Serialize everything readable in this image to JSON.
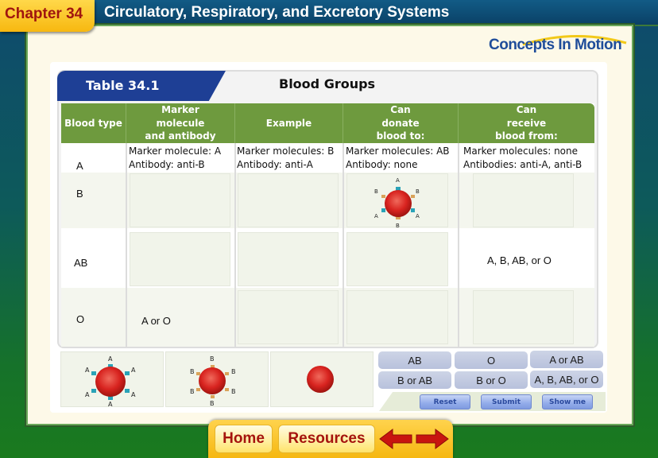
{
  "header": {
    "chapter": "Chapter 34",
    "title": "Circulatory, Respiratory, and Excretory Systems"
  },
  "logo": {
    "text": "Concepts In Motion"
  },
  "table": {
    "tab_label": "Table 34.1",
    "heading": "Blood Groups",
    "columns": [
      "Blood type",
      "Marker\nmolecule\nand antibody",
      "Example",
      "Can\ndonate\nblood to:",
      "Can\nreceive\nblood from:"
    ],
    "rows": [
      {
        "type": "A",
        "marker": "Marker molecule: A\nAntibody: anti-B",
        "example": "Marker molecules: B\nAntibody: anti-A",
        "donate": "Marker molecules: AB\nAntibody: none",
        "receive": "Marker molecules: none\nAntibodies: anti-A, anti-B"
      },
      {
        "type": "B",
        "marker": "",
        "example": "",
        "donate": "",
        "receive": ""
      },
      {
        "type": "AB",
        "marker": "",
        "example": "",
        "donate": "",
        "receive": "A, B, AB, or O"
      },
      {
        "type": "O",
        "marker": "A or O",
        "example": "",
        "donate": "",
        "receive": ""
      }
    ],
    "placed_cell_example": {
      "labels": [
        "A",
        "B",
        "B",
        "A",
        "A",
        "B"
      ],
      "description": "red blood cell with A and B markers"
    }
  },
  "pieces": {
    "cell_a": {
      "labels": [
        "A",
        "A",
        "A",
        "A",
        "A",
        "A"
      ],
      "description": "red blood cell with A markers"
    },
    "cell_b": {
      "labels": [
        "B",
        "B",
        "B",
        "B",
        "B",
        "B"
      ],
      "description": "red blood cell with B markers"
    },
    "cell_o": {
      "labels": [],
      "description": "red blood cell with no markers"
    }
  },
  "answer_chips": [
    "AB",
    "O",
    "A or AB",
    "B or AB",
    "B or O",
    "A, B, AB, or O"
  ],
  "actions": {
    "reset": "Reset",
    "submit": "Submit",
    "show_me": "Show me"
  },
  "nav": {
    "home": "Home",
    "resources": "Resources",
    "back": "back-arrow",
    "forward": "forward-arrow"
  },
  "colors": {
    "header_green": "#6e9a3e",
    "tab_blue": "#1e3f95",
    "chapter_tab": "#f7b810",
    "chapter_text": "#a0150f",
    "marker_a": "#2aa3b8",
    "marker_b": "#d9a35a",
    "rbc_red": "#d8231f"
  }
}
